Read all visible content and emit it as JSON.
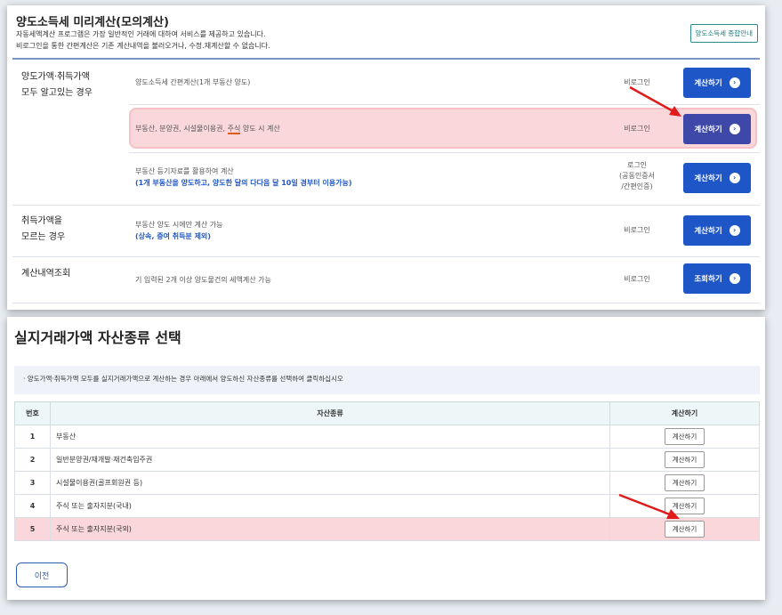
{
  "panel1": {
    "title": "양도소득세 미리계산(모의계산)",
    "desc_line1": "자동세액계산 프로그램은 가장 일반적인 거래에 대하여 서비스를 제공하고 있습니다.",
    "desc_line2": "비로그인을 통한 간편계산은 기존 계산내역을 불러오거나, 수정.재계산할 수 없습니다.",
    "guide_button": "양도소득세 종합안내",
    "sections": [
      {
        "category_line1": "양도가액·취득가액",
        "category_line2": "모두 알고있는 경우"
      },
      {
        "category_line1": "취득가액을",
        "category_line2": "모르는 경우"
      },
      {
        "category_line1": "계산내역조회",
        "category_line2": ""
      }
    ],
    "rows": [
      {
        "desc": "양도소득세 간편계산(1개 부동산 양도)",
        "login": "비로그인",
        "button": "계산하기"
      },
      {
        "desc_pre": "부동산, 분양권, 시설물이용권, ",
        "desc_mark": "주식",
        "desc_post": " 양도 시 계산",
        "login": "비로그인",
        "button": "계산하기"
      },
      {
        "desc": "부동산 등기자료를 활용하여 계산",
        "desc_blue": "(1개 부동산을 양도하고, 양도한 달의 다다음 달 10일 경부터 이용가능)",
        "login_line1": "로그인",
        "login_line2": "(공동인증서",
        "login_line3": "/간편인증)",
        "button": "계산하기"
      },
      {
        "desc": "부동산 양도 시에만 계산 가능",
        "desc_blue": "(상속, 증여 취득분 제외)",
        "login": "비로그인",
        "button": "계산하기"
      },
      {
        "desc": "기 입력된 2개 이상 양도물건의 세액계산 가능",
        "login": "비로그인",
        "button": "조회하기"
      }
    ]
  },
  "panel2": {
    "title": "실지거래가액 자산종류 선택",
    "notice": "· 양도가액·취득가액 모두를 실지거래가액으로 계산하는 경우 아래에서 양도하신 자산종류를 선택하여 클릭하십시오",
    "headers": {
      "num": "번호",
      "type": "자산종류",
      "action": "계산하기"
    },
    "rows": [
      {
        "num": "1",
        "name": "부동산",
        "button": "계산하기"
      },
      {
        "num": "2",
        "name": "일반분양권/재개발·재건축입주권",
        "button": "계산하기"
      },
      {
        "num": "3",
        "name": "시설물이용권(골프회원권 등)",
        "button": "계산하기"
      },
      {
        "num": "4",
        "name": "주식 또는 출자지분(국내)",
        "button": "계산하기"
      },
      {
        "num": "5",
        "name": "주식 또는 출자지분(국외)",
        "button": "계산하기"
      }
    ],
    "prev_button": "이전"
  },
  "colors": {
    "primary": "#1f56c7",
    "highlight": "#f9d7da",
    "annotation": "#e01b1b"
  }
}
